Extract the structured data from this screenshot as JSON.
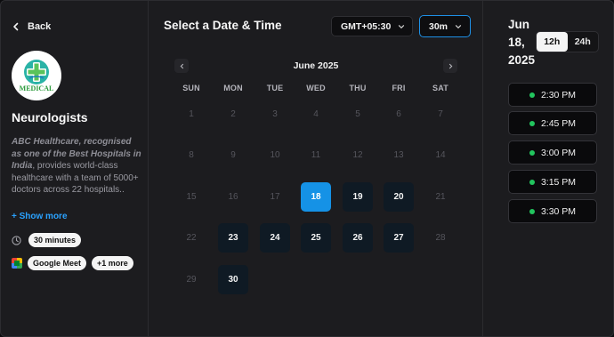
{
  "left": {
    "back_label": "Back",
    "logo_text": "MEDICAL",
    "title": "Neurologists",
    "description_bold": "ABC Healthcare, recognised as one of the Best Hospitals in India",
    "description_rest": ", provides world-class healthcare with a team of 5000+ doctors across 22 hospitals..",
    "show_more": "+ Show more",
    "duration": "30 minutes",
    "location": "Google Meet",
    "more_locations": "+1 more"
  },
  "calendar": {
    "heading": "Select a Date & Time",
    "timezone": "GMT+05:30",
    "duration_select": "30m",
    "month_label": "June 2025",
    "weekdays": [
      "SUN",
      "MON",
      "TUE",
      "WED",
      "THU",
      "FRI",
      "SAT"
    ],
    "days": [
      [
        1,
        2,
        3,
        4,
        5,
        6,
        7
      ],
      [
        8,
        9,
        10,
        11,
        12,
        13,
        14
      ],
      [
        15,
        16,
        17,
        18,
        19,
        20,
        21
      ],
      [
        22,
        23,
        24,
        25,
        26,
        27,
        28
      ],
      [
        29,
        30,
        null,
        null,
        null,
        null,
        null
      ]
    ],
    "available_days": [
      18,
      19,
      20,
      23,
      24,
      25,
      26,
      27,
      30
    ],
    "selected_day": 18
  },
  "slots_panel": {
    "date_label": "Jun 18, 2025",
    "format_12h": "12h",
    "format_24h": "24h",
    "slots": [
      "2:30 PM",
      "2:45 PM",
      "3:00 PM",
      "3:15 PM",
      "3:30 PM"
    ]
  },
  "colors": {
    "accent": "#1592e6",
    "available_dot": "#22c55e"
  }
}
